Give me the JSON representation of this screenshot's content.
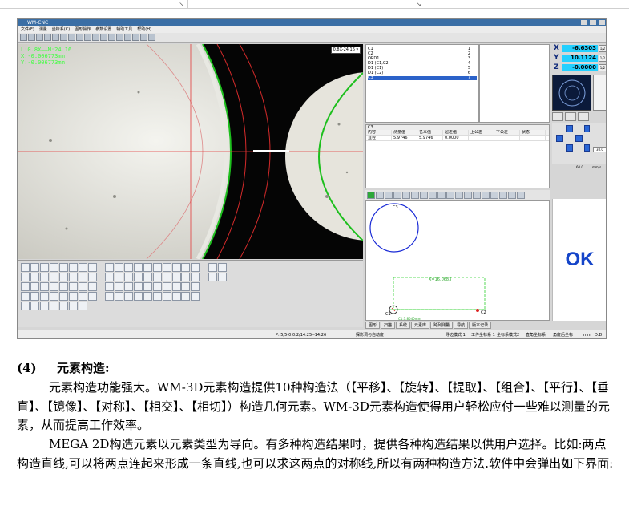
{
  "app": {
    "title": "WM-CNC",
    "menu": [
      "文件(F)",
      "测量",
      "坐标系(C)",
      "图形操作",
      "参数设置",
      "辅助工具",
      "帮助(H)"
    ],
    "camera": {
      "readout_line1": "L:0.8X——M:24.16",
      "readout_line2": "X:-0.006773mm",
      "readout_line3": "Y:-0.006773mm",
      "zoom_label": "0.8X-24.16 ▾"
    },
    "tree": {
      "rows": [
        {
          "label": "C1",
          "num": "1"
        },
        {
          "label": "C2",
          "num": "2"
        },
        {
          "label": "ORD1",
          "num": "3"
        },
        {
          "label": "D1 (C1,C2)",
          "num": "4"
        },
        {
          "label": "D1 (C1)",
          "num": "5"
        },
        {
          "label": "D1 (C2)",
          "num": "6"
        },
        {
          "label": "C3",
          "num": "7"
        }
      ]
    },
    "result": {
      "title": "C3",
      "headers": [
        "内容",
        "测量值",
        "名义值",
        "超差值",
        "上公差",
        "下公差",
        "状态"
      ],
      "row": [
        "直径",
        "5.9746",
        "5.9746",
        "0.0000",
        "",
        "",
        ""
      ]
    },
    "graph": {
      "label_c3": "C3",
      "label_dim": "X=16.0683",
      "label_c1": "C1",
      "label_c2": "C2",
      "label_coord": "C1:7.8040mm"
    },
    "graph_tabs": [
      "图形",
      "扫描",
      "系统",
      "元素库",
      "跨列测量",
      "导航",
      "版本记录"
    ],
    "dro": {
      "x_label": "X",
      "x_value": "-6.6303",
      "y_label": "Y",
      "y_value": "10.1124",
      "z_label": "Z",
      "z_value": "-0.0000",
      "half": "1/2"
    },
    "speed": {
      "box": "30.0",
      "value": "60.0",
      "unit": "mm/s"
    },
    "ok_label": "OK",
    "status": {
      "left": "P: 5/5-0:0:2/14:25--14:26",
      "mid": "探影调与自动度",
      "mode1": "寻边模式 1",
      "coord1": "工件坐标系 1",
      "coord_mode": "坐标系模式2",
      "rect": "直角坐标系",
      "angle": "角度后坐标",
      "unit": "mm",
      "fmt": "D.D"
    }
  },
  "doc": {
    "heading_num": "(4)",
    "heading_text": "元素构造:",
    "para1": "元素构造功能强大。WM-3D元素构造提供10种构造法（【平移】、【旋转】、【提取】、【组合】、【平行】、【垂直】、【镜像】、【对称】、【相交】、【相切】）构造几何元素。WM-3D元素构造使得用户轻松应付一些难以测量的元素，从而提高工作效率。",
    "para2": "MEGA 2D构造元素以元素类型为导向。有多种构造结果时，提供各种构造结果以供用户选择。比如:两点构造直线,可以将两点连起来形成一条直线,也可以求这两点的对称线,所以有两种构造方法.软件中会弹出如下界面:"
  }
}
